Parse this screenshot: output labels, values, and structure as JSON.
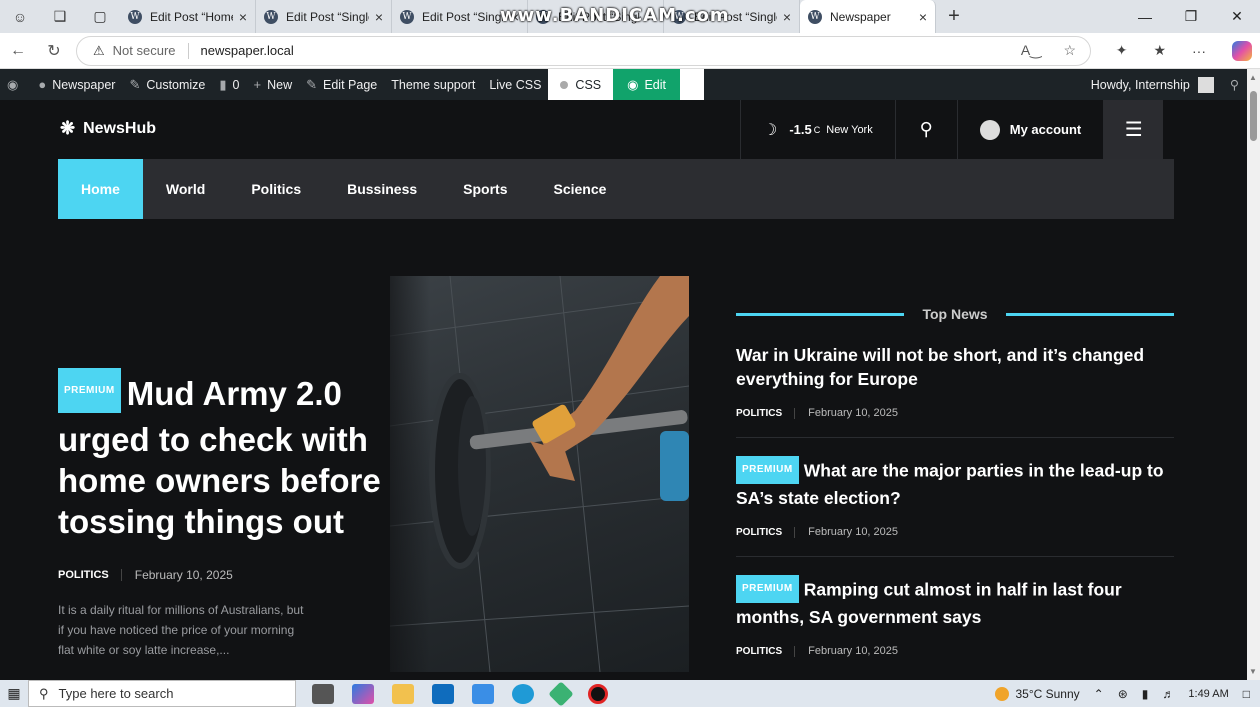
{
  "browser": {
    "tabs": [
      {
        "label": "Edit Post “Home",
        "active": false
      },
      {
        "label": "Edit Post “Single",
        "active": false
      },
      {
        "label": "Edit Post “Single",
        "active": false
      },
      {
        "label": "Edit Post “Single",
        "active": false
      },
      {
        "label": "Edit Post “Single",
        "active": false
      },
      {
        "label": "Newspaper",
        "active": true
      }
    ],
    "overlay_watermark": "www.BANDICAM.com",
    "security_label": "Not secure",
    "url": "newspaper.local"
  },
  "adminbar": {
    "site_name": "Newspaper",
    "customize": "Customize",
    "comments": "0",
    "new": "New",
    "edit_page": "Edit Page",
    "theme_support": "Theme support",
    "live_css": "Live CSS",
    "css": "CSS",
    "edit": "Edit",
    "howdy": "Howdy, Internship"
  },
  "header": {
    "logo": "NewsHub",
    "temperature": "-1.5",
    "temp_unit": "C",
    "city": "New York",
    "account": "My account"
  },
  "nav": {
    "items": [
      "Home",
      "World",
      "Politics",
      "Bussiness",
      "Sports",
      "Science"
    ],
    "active_index": 0
  },
  "hero": {
    "badge": "PREMIUM",
    "title": "Mud Army 2.0 urged to check with home owners before tossing things out",
    "category": "POLITICS",
    "date": "February 10, 2025",
    "excerpt": "It is a daily ritual for millions of Australians, but if you have noticed the price of your morning flat white or soy latte increase,..."
  },
  "top_news": {
    "heading": "Top News",
    "items": [
      {
        "badge": "",
        "title": "War in Ukraine will not be short, and it’s changed everything for Europe",
        "category": "POLITICS",
        "date": "February 10, 2025"
      },
      {
        "badge": "PREMIUM",
        "title": "What are the major parties in the lead-up to SA’s state election?",
        "category": "POLITICS",
        "date": "February 10, 2025"
      },
      {
        "badge": "PREMIUM",
        "title": "Ramping cut almost in half in last four months, SA government says",
        "category": "POLITICS",
        "date": "February 10, 2025"
      }
    ]
  },
  "taskbar": {
    "search_placeholder": "Type here to search",
    "weather": "35°C  Sunny",
    "time": "1:49 AM"
  },
  "colors": {
    "accent": "#4dd5f2",
    "site_bg": "#111214",
    "nav_bg": "#2c2d31",
    "adminbar_bg": "#1d2327",
    "edit_green": "#11a36b"
  }
}
